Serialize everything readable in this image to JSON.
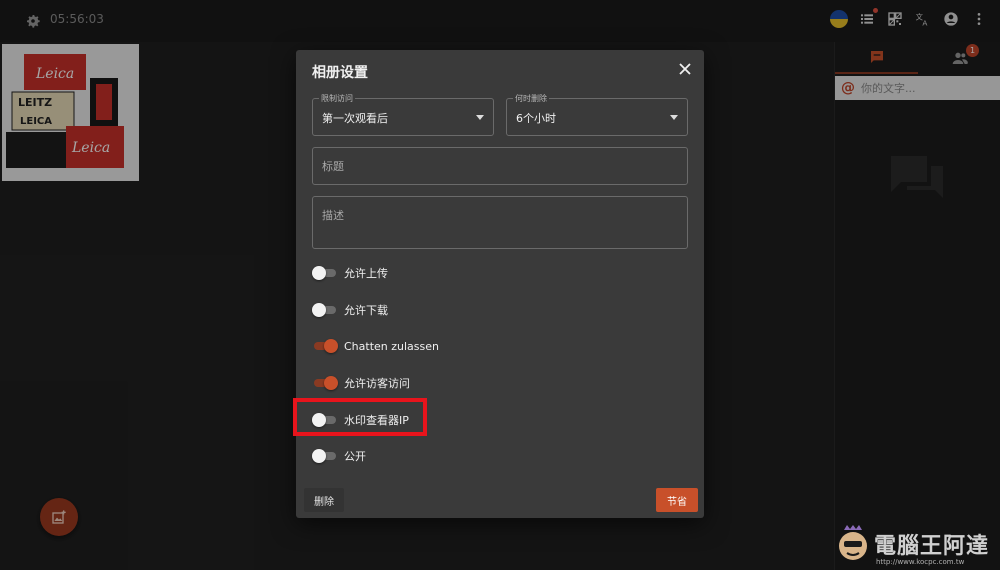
{
  "topbar": {
    "clock": "05:56:03",
    "icons": [
      "ukraine-flag-icon",
      "list-icon",
      "qr-code-icon",
      "translate-icon",
      "account-icon",
      "more-vert-icon"
    ]
  },
  "thumbnail": {
    "labels": [
      "Leica",
      "LEITZ",
      "LEICA",
      "Leica"
    ]
  },
  "right_panel": {
    "tabs": [
      "chat-tab",
      "people-tab"
    ],
    "people_badge": "1",
    "chat_placeholder": "你的文字..."
  },
  "dialog": {
    "title": "相册设置",
    "access": {
      "label": "限制访问",
      "value": "第一次观看后"
    },
    "delete_when": {
      "label": "何时删除",
      "value": "6个小时"
    },
    "title_field": {
      "placeholder": "标题"
    },
    "description_field": {
      "placeholder": "描述"
    },
    "toggles": [
      {
        "label": "允许上传",
        "on": false
      },
      {
        "label": "允许下载",
        "on": false
      },
      {
        "label": "Chatten zulassen",
        "on": true
      },
      {
        "label": "允许访客访问",
        "on": true
      },
      {
        "label": "水印查看器IP",
        "on": false
      },
      {
        "label": "公开",
        "on": false
      }
    ],
    "delete_label": "删除",
    "save_label": "节省"
  },
  "colors": {
    "accent": "#c8502a",
    "highlight": "#e8141c"
  },
  "watermark": {
    "text": "電腦王阿達",
    "url": "http://www.kocpc.com.tw"
  }
}
